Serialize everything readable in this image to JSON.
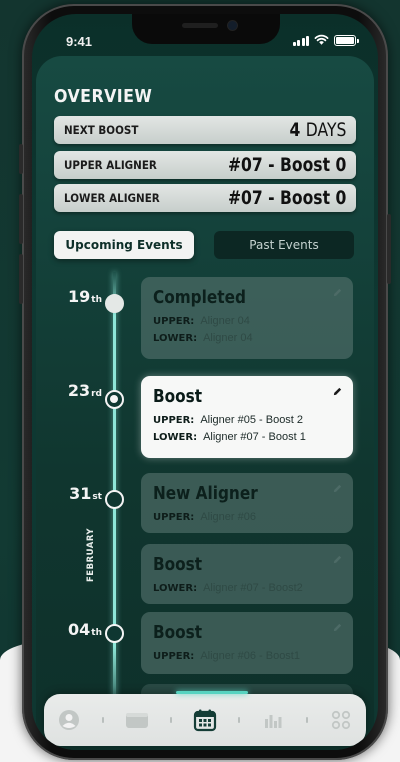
{
  "status": {
    "time": "9:41"
  },
  "overview": {
    "title": "OVERVIEW",
    "rows": [
      {
        "label": "NEXT BOOST",
        "value_num": "4",
        "value_unit": "DAYS"
      },
      {
        "label": "UPPER ALIGNER",
        "value": "#07 - Boost 0"
      },
      {
        "label": "LOWER ALIGNER",
        "value": "#07 - Boost 0"
      }
    ]
  },
  "tabs": {
    "upcoming": "Upcoming Events",
    "past": "Past Events"
  },
  "timeline": {
    "month": "FEBRUARY",
    "dates": [
      {
        "day": "19",
        "suffix": "th"
      },
      {
        "day": "23",
        "suffix": "rd"
      },
      {
        "day": "31",
        "suffix": "st"
      },
      {
        "day": "04",
        "suffix": "th"
      }
    ],
    "events": [
      {
        "title": "Completed",
        "rows": [
          {
            "k": "UPPER:",
            "v": "Aligner 04"
          },
          {
            "k": "LOWER:",
            "v": "Aligner 04"
          }
        ]
      },
      {
        "title": "Boost",
        "rows": [
          {
            "k": "UPPER:",
            "v": "Aligner #05 - Boost 2"
          },
          {
            "k": "LOWER:",
            "v": "Aligner #07 - Boost 1"
          }
        ]
      },
      {
        "title": "New Aligner",
        "rows": [
          {
            "k": "UPPER:",
            "v": "Aligner #06"
          }
        ]
      },
      {
        "title": "Boost",
        "rows": [
          {
            "k": "LOWER:",
            "v": "Aligner #07 - Boost2"
          }
        ]
      },
      {
        "title": "Boost",
        "rows": [
          {
            "k": "UPPER:",
            "v": "Aligner #06 - Boost1"
          }
        ]
      }
    ]
  },
  "nav": {
    "items": [
      "profile-icon",
      "wallet-icon",
      "calendar-icon",
      "chart-icon",
      "apps-icon"
    ],
    "active": "calendar-icon"
  },
  "colors": {
    "accent": "#57d3c0",
    "background": "#0f3731",
    "card_active": "#f7f8f7"
  }
}
